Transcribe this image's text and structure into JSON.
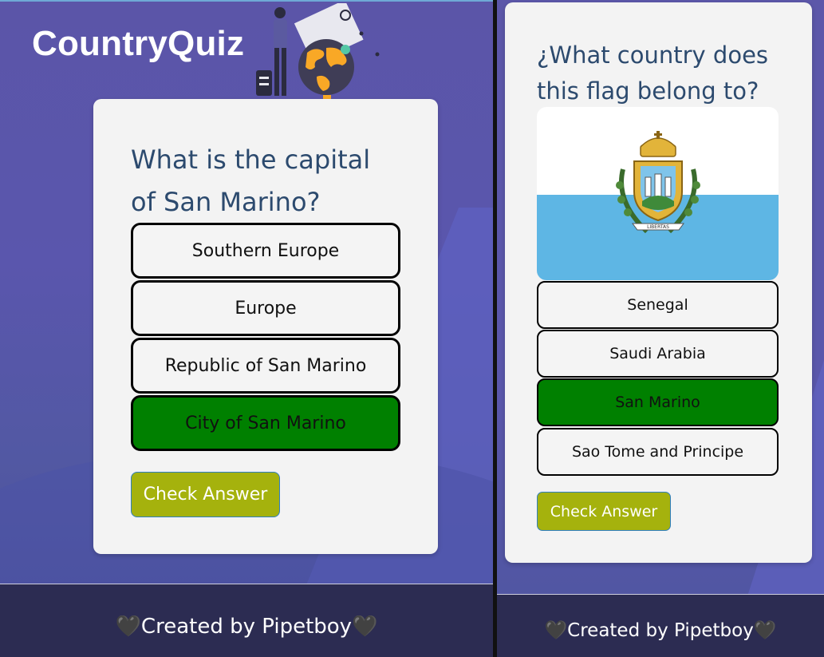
{
  "left": {
    "brand": "CountryQuiz",
    "question": "What is the capital of San Marino?",
    "options": [
      {
        "label": "Southern Europe",
        "selected": false
      },
      {
        "label": "Europe",
        "selected": false
      },
      {
        "label": "Republic of San Marino",
        "selected": false
      },
      {
        "label": "City of San Marino",
        "selected": true
      }
    ],
    "check_button": "Check Answer",
    "footer": {
      "heart_left": "🖤",
      "text": "Created by Pipetboy",
      "heart_right": "🖤"
    }
  },
  "right": {
    "question": "¿What country does this flag belong to?",
    "flag_motto": "LIBERTAS",
    "options": [
      {
        "label": "Senegal",
        "selected": false
      },
      {
        "label": "Saudi Arabia",
        "selected": false
      },
      {
        "label": "San Marino",
        "selected": true
      },
      {
        "label": "Sao Tome and Principe",
        "selected": false
      }
    ],
    "check_button": "Check Answer",
    "footer": {
      "heart_left": "🖤",
      "text": "Created by Pipetboy",
      "heart_right": "🖤"
    }
  },
  "colors": {
    "selected_option": "#008000",
    "check_button": "#a5b20d",
    "question_text": "#2c4a6e",
    "footer_bg": "#2c2c52"
  }
}
